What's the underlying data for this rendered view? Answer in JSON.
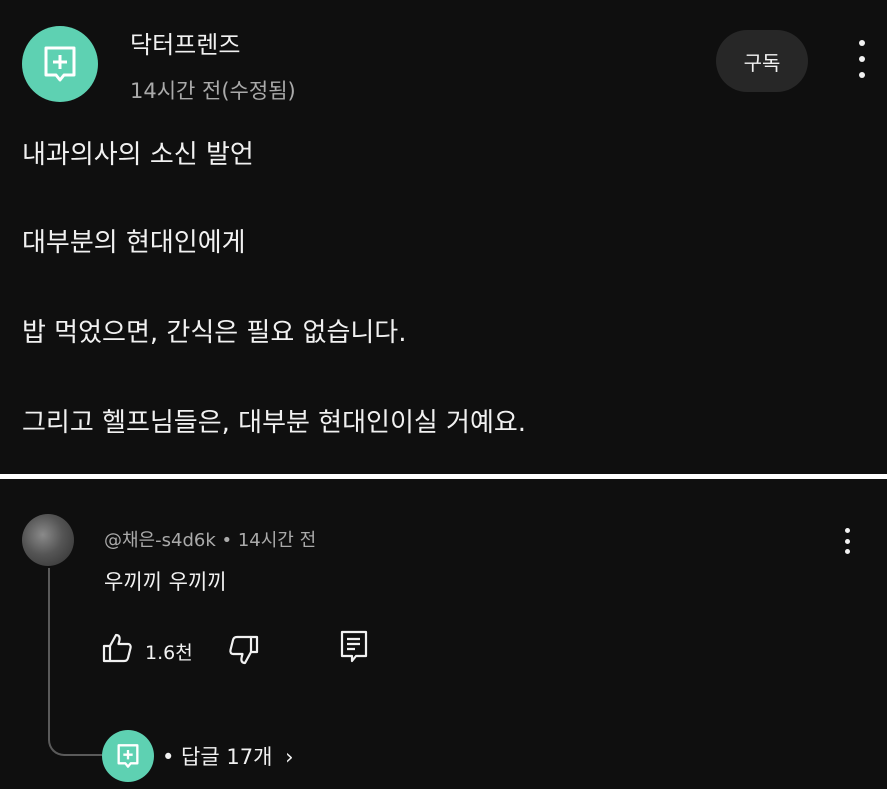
{
  "post": {
    "channel_name": "닥터프렌즈",
    "timestamp": "14시간 전(수정됨)",
    "subscribe_label": "구독",
    "lines": [
      "내과의사의 소신 발언",
      "대부분의 현대인에게",
      "밥 먹었으면, 간식은 필요 없습니다.",
      "그리고 헬프님들은, 대부분 현대인이실 거예요."
    ]
  },
  "comment": {
    "author": "@채은-s4d6k",
    "separator": "•",
    "timestamp": "14시간 전",
    "text": "우끼끼 우끼끼",
    "like_count": "1.6천"
  },
  "replies": {
    "label": "• 답글 17개",
    "chevron": "›"
  },
  "icons": {
    "channel_avatar": "plus-square-icon",
    "like": "thumbs-up-icon",
    "dislike": "thumbs-down-icon",
    "reply": "reply-icon",
    "more": "more-vertical-icon"
  },
  "colors": {
    "background": "#0f0f0f",
    "brand_mint": "#5ed1b2",
    "secondary_text": "#aaaaaa",
    "button_bg": "#272727"
  }
}
